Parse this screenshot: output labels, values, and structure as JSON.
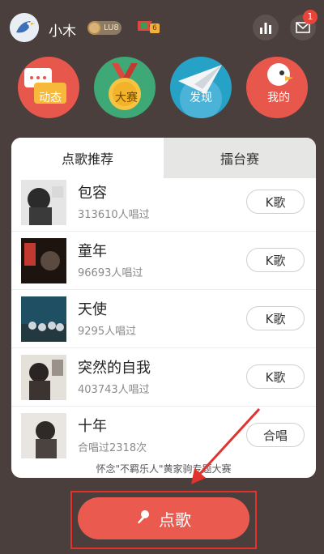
{
  "header": {
    "username": "小木",
    "level_badge": "LU8",
    "flag_count": "6",
    "notification_count": "1"
  },
  "nav": [
    {
      "label": "动态"
    },
    {
      "label": "大赛"
    },
    {
      "label": "发现"
    },
    {
      "label": "我的"
    }
  ],
  "tabs": {
    "active": "点歌推荐",
    "inactive": "擂台赛"
  },
  "songs": [
    {
      "title": "包容",
      "sub": "313610人唱过",
      "action": "K歌"
    },
    {
      "title": "童年",
      "sub": "96693人唱过",
      "action": "K歌"
    },
    {
      "title": "天使",
      "sub": "9295人唱过",
      "action": "K歌"
    },
    {
      "title": "突然的自我",
      "sub": "403743人唱过",
      "action": "K歌"
    },
    {
      "title": "十年",
      "sub": "合唱过2318次",
      "action": "合唱"
    }
  ],
  "footer_text": "怀念\"不羁乐人\"黄家驹专题大赛",
  "main_button": "点歌",
  "colors": {
    "background": "#4a3f3c",
    "accent": "#ea5a4f",
    "highlight": "#e1322d"
  }
}
